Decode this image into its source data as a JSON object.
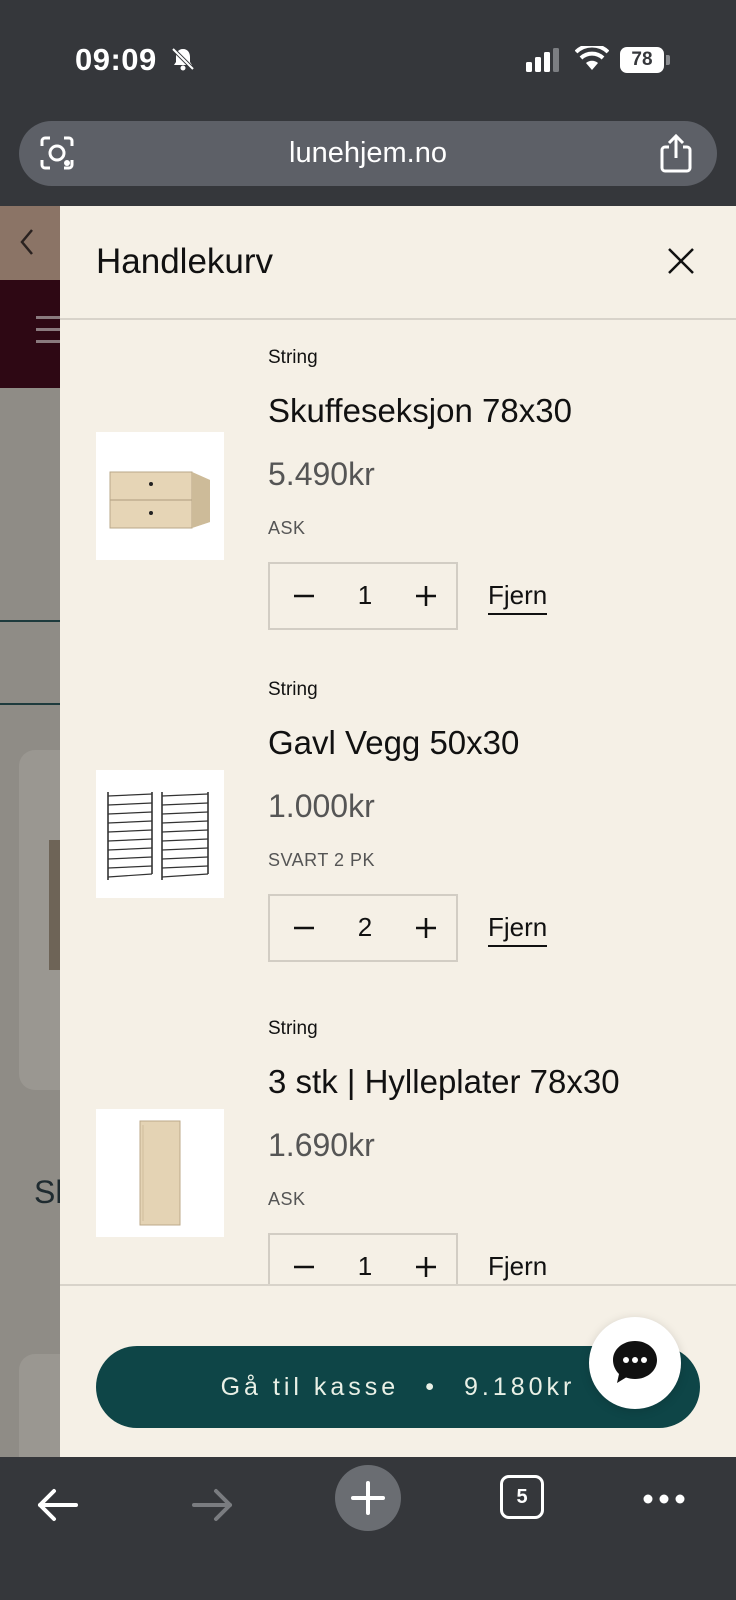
{
  "status_bar": {
    "time": "09:09",
    "battery": "78"
  },
  "browser": {
    "url": "lunehjem.no",
    "tab_count": "5"
  },
  "drawer": {
    "title": "Handlekurv",
    "items": [
      {
        "brand": "String",
        "name": "Skuffeseksjon 78x30",
        "price": "5.490kr",
        "variant": "ASK",
        "quantity": "1",
        "remove_label": "Fjern",
        "image_icon": "drawer-section-image"
      },
      {
        "brand": "String",
        "name": "Gavl Vegg 50x30",
        "price": "1.000kr",
        "variant": "SVART 2 PK",
        "quantity": "2",
        "remove_label": "Fjern",
        "image_icon": "wall-panel-image"
      },
      {
        "brand": "String",
        "name": "3 stk | Hylleplater 78x30",
        "price": "1.690kr",
        "variant": "ASK",
        "quantity": "1",
        "remove_label": "Fjern",
        "image_icon": "shelf-board-image"
      }
    ],
    "checkout": {
      "label": "Gå til kasse",
      "separator": "•",
      "total": "9.180kr"
    }
  },
  "background_page": {
    "partial_text": "Sk"
  },
  "colors": {
    "checkout_bg": "#0e4547",
    "drawer_bg": "#f5f0e6",
    "browser_chrome": "#35373b"
  }
}
